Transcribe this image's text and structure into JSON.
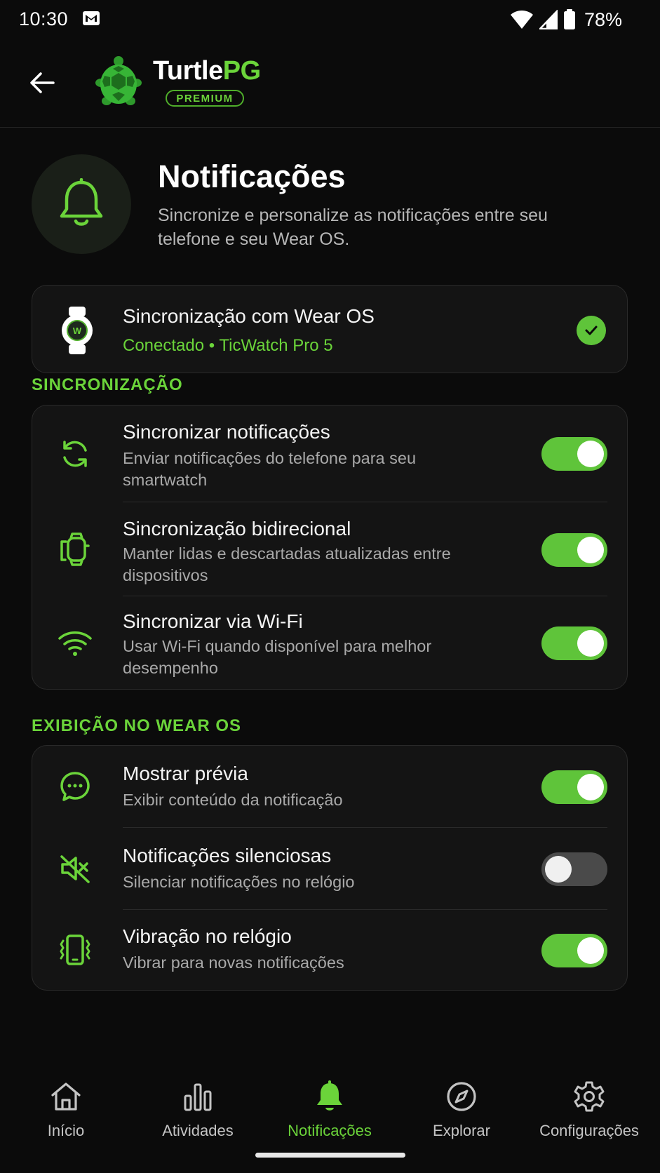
{
  "status_bar": {
    "time": "10:30",
    "battery": "78%",
    "icons": [
      "gmail-icon",
      "wifi-icon",
      "cellular-signal-icon",
      "battery-icon"
    ]
  },
  "header": {
    "brand_prefix": "Turtle",
    "brand_suffix": "PG",
    "badge": "PREMIUM",
    "logo_icon": "turtle-logo",
    "back_icon": "arrow-left-icon"
  },
  "intro": {
    "icon": "bell-icon",
    "title": "Notificações",
    "subtitle": "Sincronize e personalize as notificações entre seu telefone e seu Wear OS."
  },
  "device_card": {
    "icon": "smartwatch-icon",
    "title": "Sincronização com Wear OS",
    "status": "Conectado • TicWatch Pro 5",
    "status_icon": "check-circle-icon"
  },
  "sections": [
    {
      "label": "SINCRONIZAÇÃO",
      "rows": [
        {
          "icon": "sync-icon",
          "title": "Sincronizar notificações",
          "description": "Enviar notificações do telefone para seu smartwatch",
          "enabled": true
        },
        {
          "icon": "watch-sync-icon",
          "title": "Sincronização bidirecional",
          "description": "Manter lidas e descartadas atualizadas entre dispositivos",
          "enabled": true
        },
        {
          "icon": "wifi-icon",
          "title": "Sincronizar via Wi-Fi",
          "description": "Usar Wi-Fi quando disponível para melhor desempenho",
          "enabled": true
        }
      ]
    },
    {
      "label": "EXIBIÇÃO NO WEAR OS",
      "rows": [
        {
          "icon": "message-preview-icon",
          "title": "Mostrar prévia",
          "description": "Exibir conteúdo da notificação",
          "enabled": true
        },
        {
          "icon": "volume-mute-icon",
          "title": "Notificações silenciosas",
          "description": "Silenciar notificações no relógio",
          "enabled": false
        },
        {
          "icon": "vibration-icon",
          "title": "Vibração no relógio",
          "description": "Vibrar para novas notificações",
          "enabled": true
        }
      ]
    }
  ],
  "bottom_nav": [
    {
      "label": "Início",
      "icon": "home-icon",
      "active": false
    },
    {
      "label": "Atividades",
      "icon": "bar-chart-icon",
      "active": false
    },
    {
      "label": "Notificações",
      "icon": "bell-icon",
      "active": true
    },
    {
      "label": "Explorar",
      "icon": "compass-icon",
      "active": false
    },
    {
      "label": "Configurações",
      "icon": "gear-icon",
      "active": false
    }
  ],
  "colors": {
    "accent": "#6bd43a",
    "background": "#0b0b0b",
    "card": "#141414",
    "toggle_on": "#5fc43a",
    "toggle_off": "#4a4a4a"
  }
}
